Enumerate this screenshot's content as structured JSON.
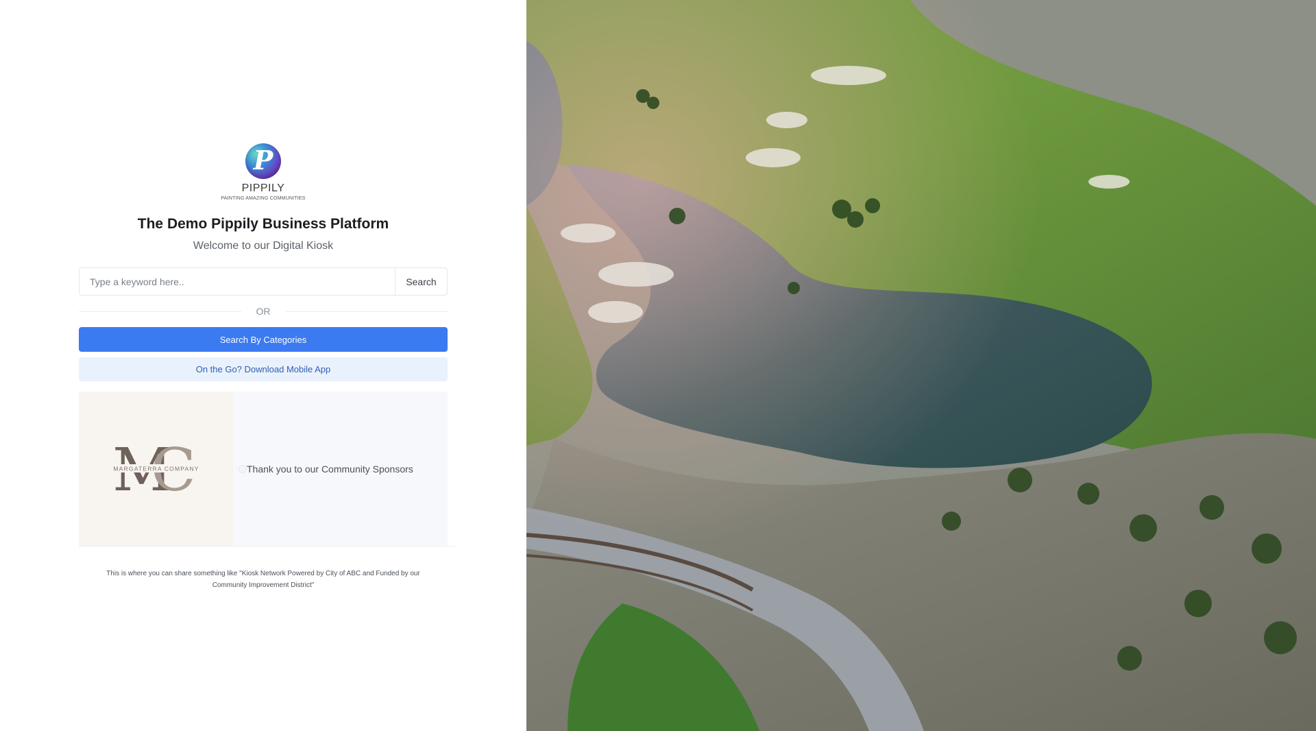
{
  "brand": {
    "logo_letter": "P",
    "name": "PIPPILY",
    "tagline": "PAINTING AMAZING COMMUNITIES"
  },
  "page": {
    "title": "The Demo Pippily Business Platform",
    "subtitle": "Welcome to our Digital Kiosk"
  },
  "search": {
    "placeholder": "Type a keyword here..",
    "button_label": "Search"
  },
  "divider_text": "OR",
  "buttons": {
    "categories_label": "Search By Categories",
    "mobile_app_label": "On the Go? Download Mobile App"
  },
  "sponsor": {
    "logo_monogram": "MC",
    "logo_text": "MARGATERRA COMPANY",
    "message": "Thank you to our Community Sponsors"
  },
  "footer": {
    "note": "This is where you can share something like \"Kiosk Network Powered by City of ABC and Funded by our Community Improvement District\""
  },
  "colors": {
    "primary": "#3b7af0",
    "secondary_bg": "#e9f1fd",
    "secondary_text": "#2f5fb0"
  }
}
